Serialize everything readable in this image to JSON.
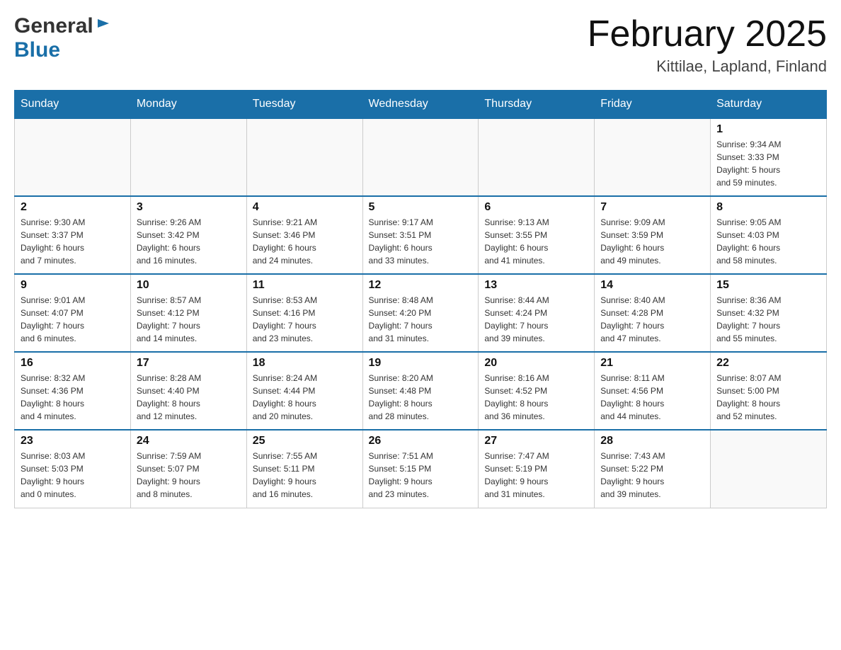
{
  "header": {
    "logo_general": "General",
    "logo_blue": "Blue",
    "month_year": "February 2025",
    "location": "Kittilae, Lapland, Finland"
  },
  "weekdays": [
    "Sunday",
    "Monday",
    "Tuesday",
    "Wednesday",
    "Thursday",
    "Friday",
    "Saturday"
  ],
  "weeks": [
    [
      {
        "day": "",
        "info": ""
      },
      {
        "day": "",
        "info": ""
      },
      {
        "day": "",
        "info": ""
      },
      {
        "day": "",
        "info": ""
      },
      {
        "day": "",
        "info": ""
      },
      {
        "day": "",
        "info": ""
      },
      {
        "day": "1",
        "info": "Sunrise: 9:34 AM\nSunset: 3:33 PM\nDaylight: 5 hours\nand 59 minutes."
      }
    ],
    [
      {
        "day": "2",
        "info": "Sunrise: 9:30 AM\nSunset: 3:37 PM\nDaylight: 6 hours\nand 7 minutes."
      },
      {
        "day": "3",
        "info": "Sunrise: 9:26 AM\nSunset: 3:42 PM\nDaylight: 6 hours\nand 16 minutes."
      },
      {
        "day": "4",
        "info": "Sunrise: 9:21 AM\nSunset: 3:46 PM\nDaylight: 6 hours\nand 24 minutes."
      },
      {
        "day": "5",
        "info": "Sunrise: 9:17 AM\nSunset: 3:51 PM\nDaylight: 6 hours\nand 33 minutes."
      },
      {
        "day": "6",
        "info": "Sunrise: 9:13 AM\nSunset: 3:55 PM\nDaylight: 6 hours\nand 41 minutes."
      },
      {
        "day": "7",
        "info": "Sunrise: 9:09 AM\nSunset: 3:59 PM\nDaylight: 6 hours\nand 49 minutes."
      },
      {
        "day": "8",
        "info": "Sunrise: 9:05 AM\nSunset: 4:03 PM\nDaylight: 6 hours\nand 58 minutes."
      }
    ],
    [
      {
        "day": "9",
        "info": "Sunrise: 9:01 AM\nSunset: 4:07 PM\nDaylight: 7 hours\nand 6 minutes."
      },
      {
        "day": "10",
        "info": "Sunrise: 8:57 AM\nSunset: 4:12 PM\nDaylight: 7 hours\nand 14 minutes."
      },
      {
        "day": "11",
        "info": "Sunrise: 8:53 AM\nSunset: 4:16 PM\nDaylight: 7 hours\nand 23 minutes."
      },
      {
        "day": "12",
        "info": "Sunrise: 8:48 AM\nSunset: 4:20 PM\nDaylight: 7 hours\nand 31 minutes."
      },
      {
        "day": "13",
        "info": "Sunrise: 8:44 AM\nSunset: 4:24 PM\nDaylight: 7 hours\nand 39 minutes."
      },
      {
        "day": "14",
        "info": "Sunrise: 8:40 AM\nSunset: 4:28 PM\nDaylight: 7 hours\nand 47 minutes."
      },
      {
        "day": "15",
        "info": "Sunrise: 8:36 AM\nSunset: 4:32 PM\nDaylight: 7 hours\nand 55 minutes."
      }
    ],
    [
      {
        "day": "16",
        "info": "Sunrise: 8:32 AM\nSunset: 4:36 PM\nDaylight: 8 hours\nand 4 minutes."
      },
      {
        "day": "17",
        "info": "Sunrise: 8:28 AM\nSunset: 4:40 PM\nDaylight: 8 hours\nand 12 minutes."
      },
      {
        "day": "18",
        "info": "Sunrise: 8:24 AM\nSunset: 4:44 PM\nDaylight: 8 hours\nand 20 minutes."
      },
      {
        "day": "19",
        "info": "Sunrise: 8:20 AM\nSunset: 4:48 PM\nDaylight: 8 hours\nand 28 minutes."
      },
      {
        "day": "20",
        "info": "Sunrise: 8:16 AM\nSunset: 4:52 PM\nDaylight: 8 hours\nand 36 minutes."
      },
      {
        "day": "21",
        "info": "Sunrise: 8:11 AM\nSunset: 4:56 PM\nDaylight: 8 hours\nand 44 minutes."
      },
      {
        "day": "22",
        "info": "Sunrise: 8:07 AM\nSunset: 5:00 PM\nDaylight: 8 hours\nand 52 minutes."
      }
    ],
    [
      {
        "day": "23",
        "info": "Sunrise: 8:03 AM\nSunset: 5:03 PM\nDaylight: 9 hours\nand 0 minutes."
      },
      {
        "day": "24",
        "info": "Sunrise: 7:59 AM\nSunset: 5:07 PM\nDaylight: 9 hours\nand 8 minutes."
      },
      {
        "day": "25",
        "info": "Sunrise: 7:55 AM\nSunset: 5:11 PM\nDaylight: 9 hours\nand 16 minutes."
      },
      {
        "day": "26",
        "info": "Sunrise: 7:51 AM\nSunset: 5:15 PM\nDaylight: 9 hours\nand 23 minutes."
      },
      {
        "day": "27",
        "info": "Sunrise: 7:47 AM\nSunset: 5:19 PM\nDaylight: 9 hours\nand 31 minutes."
      },
      {
        "day": "28",
        "info": "Sunrise: 7:43 AM\nSunset: 5:22 PM\nDaylight: 9 hours\nand 39 minutes."
      },
      {
        "day": "",
        "info": ""
      }
    ]
  ]
}
